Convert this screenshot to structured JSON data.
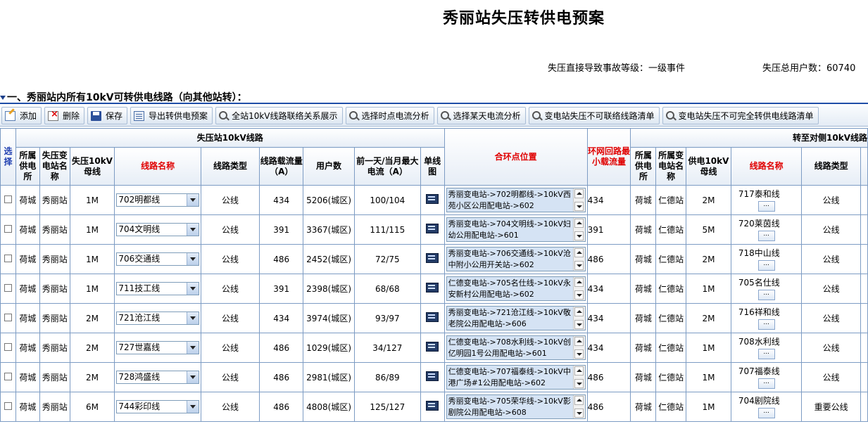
{
  "page_title": "秀丽站失压转供电预案",
  "info": {
    "event_level": "失压直接导致事故等级：一级事件",
    "total_users": "失压总用户数：60740"
  },
  "section_title": "一、秀丽站内所有10kV可转供电线路（向其他站转）：",
  "toolbar": [
    {
      "label": "添加",
      "icon": "add-icon"
    },
    {
      "label": "删除",
      "icon": "delete-icon"
    },
    {
      "label": "保存",
      "icon": "save-icon"
    },
    {
      "label": "导出转供电预案",
      "icon": "export-icon"
    },
    {
      "label": "全站10kV线路联络关系展示",
      "icon": "search-icon"
    },
    {
      "label": "选择时点电流分析",
      "icon": "search-icon"
    },
    {
      "label": "选择某天电流分析",
      "icon": "search-icon"
    },
    {
      "label": "变电站失压不可联络线路清单",
      "icon": "search-icon"
    },
    {
      "label": "变电站失压不可完全转供电线路清单",
      "icon": "search-icon"
    }
  ],
  "headers": {
    "select": "选择",
    "group_left": "失压站10kV线路",
    "group_right": "转至对侧10kV线路",
    "supply_office": "所属供电所",
    "station_name": "失压变电站名称",
    "bus": "失压10kV母线",
    "line_name": "线路名称",
    "line_type": "线路类型",
    "capacity": "线路载流量（A）",
    "users": "用户数",
    "max_current": "前一天/当月最大电流（A）",
    "diagram": "单线图",
    "ring_point": "合环点位置",
    "min_capacity": "环网回路最小载流量",
    "r_supply_office": "所属供电所",
    "r_station_name": "所属变电站名称",
    "r_bus": "供电10kV母线",
    "r_line_name": "线路名称",
    "r_line_type": "线路类型"
  },
  "rows": [
    {
      "office": "荷城",
      "station": "秀丽站",
      "bus": "1M",
      "line": "702明都线",
      "type": "公线",
      "cap": "434",
      "users": "5206(城区)",
      "cur": "100/104",
      "ring": "秀丽变电站->702明都线->10kV西苑小区公用配电站->602",
      "min": "434",
      "r_office": "荷城",
      "r_station": "仁德站",
      "r_bus": "2M",
      "r_line": "717泰和线",
      "r_type": "公线"
    },
    {
      "office": "荷城",
      "station": "秀丽站",
      "bus": "1M",
      "line": "704文明线",
      "type": "公线",
      "cap": "391",
      "users": "3367(城区)",
      "cur": "111/115",
      "ring": "秀丽变电站->704文明线->10kV妇幼公用配电站->601",
      "min": "391",
      "r_office": "荷城",
      "r_station": "仁德站",
      "r_bus": "5M",
      "r_line": "720莱茵线",
      "r_type": "公线"
    },
    {
      "office": "荷城",
      "station": "秀丽站",
      "bus": "1M",
      "line": "706交通线",
      "type": "公线",
      "cap": "486",
      "users": "2452(城区)",
      "cur": "72/75",
      "ring": "秀丽变电站->706交通线->10kV沧中附小公用开关站->602",
      "min": "486",
      "r_office": "荷城",
      "r_station": "仁德站",
      "r_bus": "2M",
      "r_line": "718中山线",
      "r_type": "公线"
    },
    {
      "office": "荷城",
      "station": "秀丽站",
      "bus": "1M",
      "line": "711技工线",
      "type": "公线",
      "cap": "391",
      "users": "2398(城区)",
      "cur": "68/68",
      "ring": "仁德变电站->705名仕线->10kV永安新村公用配电站->602",
      "min": "434",
      "r_office": "荷城",
      "r_station": "仁德站",
      "r_bus": "1M",
      "r_line": "705名仕线",
      "r_type": "公线"
    },
    {
      "office": "荷城",
      "station": "秀丽站",
      "bus": "2M",
      "line": "721沧江线",
      "type": "公线",
      "cap": "434",
      "users": "3974(城区)",
      "cur": "93/97",
      "ring": "秀丽变电站->721沧江线->10kV敬老院公用配电站->606",
      "min": "434",
      "r_office": "荷城",
      "r_station": "仁德站",
      "r_bus": "2M",
      "r_line": "716祥和线",
      "r_type": "公线"
    },
    {
      "office": "荷城",
      "station": "秀丽站",
      "bus": "2M",
      "line": "727世嘉线",
      "type": "公线",
      "cap": "486",
      "users": "1029(城区)",
      "cur": "34/127",
      "ring": "仁德变电站->708水利线->10kV创亿明园1号公用配电站->601",
      "min": "434",
      "r_office": "荷城",
      "r_station": "仁德站",
      "r_bus": "1M",
      "r_line": "708水利线",
      "r_type": "公线"
    },
    {
      "office": "荷城",
      "station": "秀丽站",
      "bus": "2M",
      "line": "728鸿盛线",
      "type": "公线",
      "cap": "486",
      "users": "2981(城区)",
      "cur": "86/89",
      "ring": "仁德变电站->707福泰线->10kV中港广场#1公用配电站->602",
      "min": "486",
      "r_office": "荷城",
      "r_station": "仁德站",
      "r_bus": "1M",
      "r_line": "707福泰线",
      "r_type": "公线"
    },
    {
      "office": "荷城",
      "station": "秀丽站",
      "bus": "6M",
      "line": "744彩印线",
      "type": "公线",
      "cap": "486",
      "users": "4808(城区)",
      "cur": "125/127",
      "ring": "秀丽变电站->705荣华线->10kV影剧院公用配电站->608",
      "min": "486",
      "r_office": "荷城",
      "r_station": "仁德站",
      "r_bus": "1M",
      "r_line": "704剧院线",
      "r_type": "重要公线"
    }
  ],
  "pick_label": "..."
}
